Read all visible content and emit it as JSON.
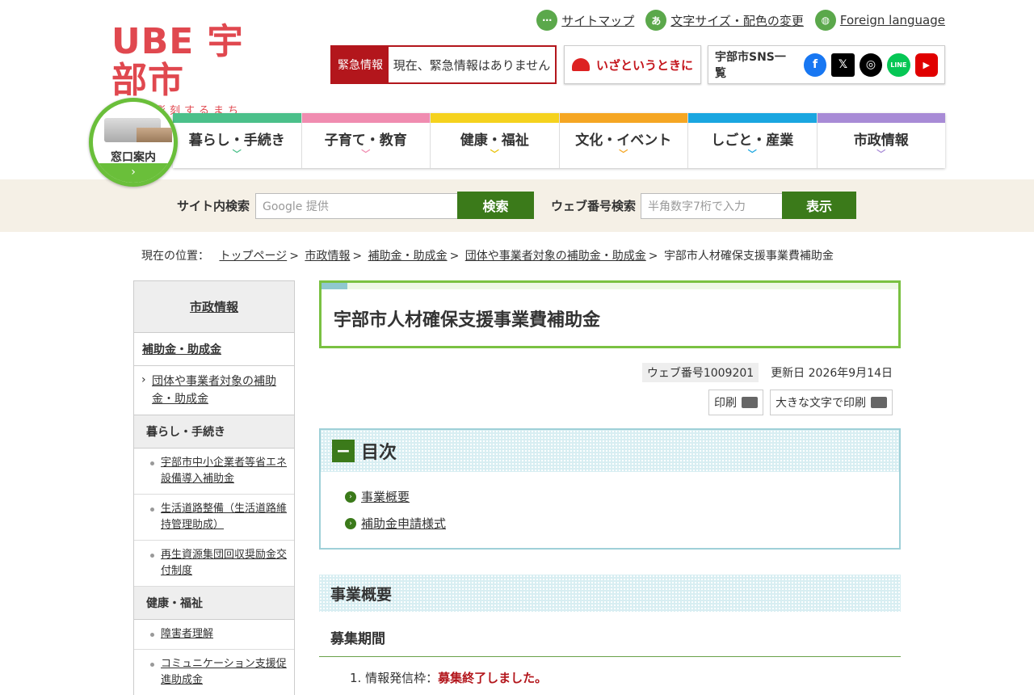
{
  "header": {
    "logo_main": "UBE 宇部市",
    "logo_sub": "未来を彫刻するまち",
    "toplinks": [
      {
        "icon": "share-icon",
        "glyph": "⋯",
        "label": "サイトマップ"
      },
      {
        "icon": "text-size-icon",
        "glyph": "あ",
        "label": "文字サイズ・配色の変更"
      },
      {
        "icon": "globe-icon",
        "glyph": "◍",
        "label": "Foreign language"
      }
    ],
    "emergency_label": "緊急情報",
    "emergency_text": "現在、緊急情報はありません",
    "disaster_link": "いざというときに",
    "sns_label": "宇部市SNS一覧",
    "sns": [
      {
        "icon": "facebook-icon",
        "glyph": "f",
        "color": "#1877f2"
      },
      {
        "icon": "x-icon",
        "glyph": "𝕏",
        "color": "#000000"
      },
      {
        "icon": "instagram-icon",
        "glyph": "◎",
        "color": "#000000"
      },
      {
        "icon": "line-icon",
        "glyph": "LINE",
        "color": "#06c755"
      },
      {
        "icon": "youtube-icon",
        "glyph": "▶",
        "color": "#e00000"
      }
    ]
  },
  "madoguchi": {
    "label": "窓口案内",
    "arrow": "›"
  },
  "gnav": [
    {
      "label": "暮らし・手続き",
      "color": "#4bc08a"
    },
    {
      "label": "子育て・教育",
      "color": "#f08cb0"
    },
    {
      "label": "健康・福祉",
      "color": "#f5d21e"
    },
    {
      "label": "文化・イベント",
      "color": "#f5a623"
    },
    {
      "label": "しごと・産業",
      "color": "#1aa6e0"
    },
    {
      "label": "市政情報",
      "color": "#a88bd6"
    }
  ],
  "search": {
    "site_label": "サイト内検索",
    "site_placeholder": "Google 提供",
    "site_button": "検索",
    "web_label": "ウェブ番号検索",
    "web_placeholder": "半角数字7桁で入力",
    "web_button": "表示"
  },
  "breadcrumb": {
    "prefix": "現在の位置：",
    "items": [
      "トップページ",
      "市政情報",
      "補助金・助成金",
      "団体や事業者対象の補助金・助成金"
    ],
    "current": "宇部市人材確保支援事業費補助金"
  },
  "sidenav": {
    "head": "市政情報",
    "sub": "補助金・助成金",
    "current": "団体や事業者対象の補助金・助成金",
    "cat1": "暮らし・手続き",
    "cat1_links": [
      "宇部市中小企業者等省エネ設備導入補助金",
      "生活道路整備（生活道路維持管理助成）",
      "再生資源集団回収奨励金交付制度"
    ],
    "cat2": "健康・福祉",
    "cat2_links": [
      "障害者理解",
      "コミュニケーション支援促進助成金"
    ]
  },
  "main": {
    "title": "宇部市人材確保支援事業費補助金",
    "web_no": "ウェブ番号1009201",
    "updated": "更新日 2026年9月14日",
    "print": "印刷",
    "print_large": "大きな文字で印刷",
    "toc_title": "目次",
    "toc_items": [
      "事業概要",
      "補助金申請様式"
    ],
    "section1": "事業概要",
    "subsection1": "募集期間",
    "list_item_prefix": "1. 情報発信枠：",
    "list_item_status": "募集終了しました。"
  }
}
